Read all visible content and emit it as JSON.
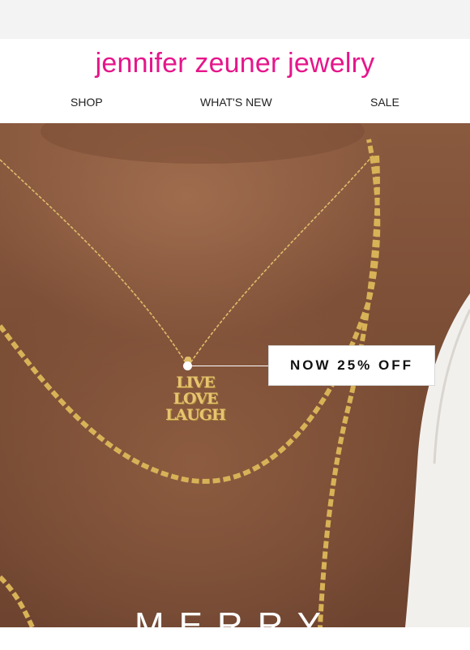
{
  "brand": {
    "name": "jennifer zeuner jewelry",
    "color": "#e6158a"
  },
  "nav": {
    "items": [
      {
        "label": "SHOP"
      },
      {
        "label": "WHAT'S NEW"
      },
      {
        "label": "SALE"
      }
    ]
  },
  "hero": {
    "promo_label": "NOW 25% OFF",
    "pendant_lines": [
      "LIVE",
      "LOVE",
      "LAUGH"
    ],
    "headline_partial": "MERRY"
  }
}
